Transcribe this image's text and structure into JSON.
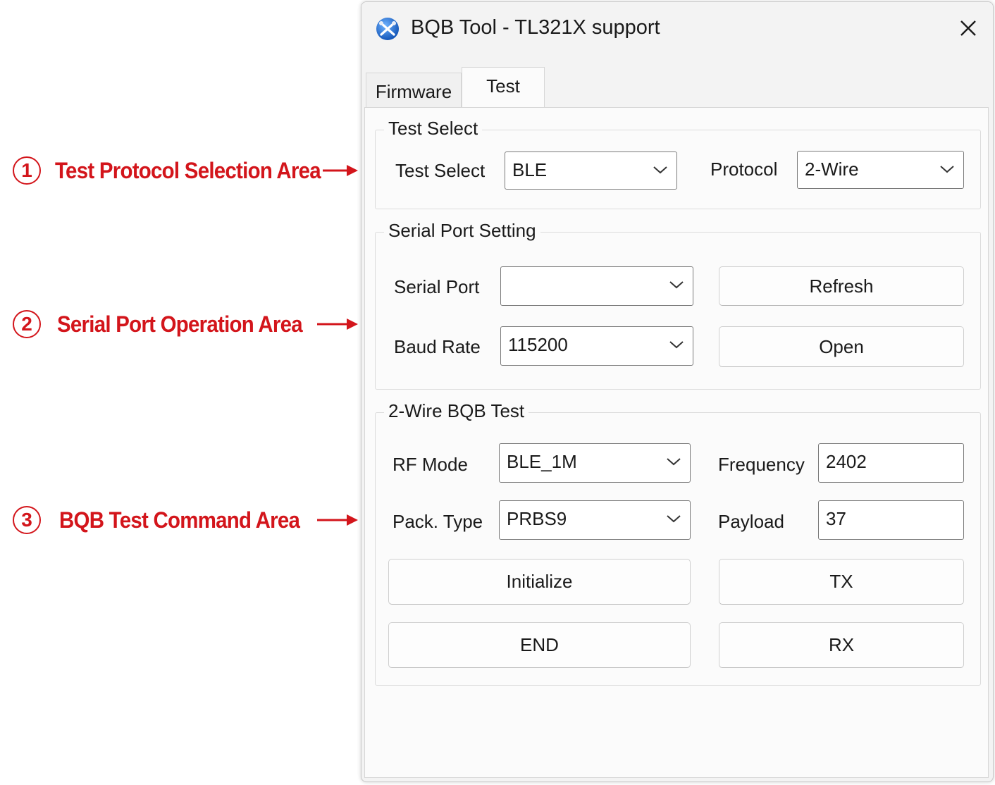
{
  "annotations": [
    {
      "number": "1",
      "text": "Test Protocol Selection Area"
    },
    {
      "number": "2",
      "text": "Serial Port Operation Area"
    },
    {
      "number": "3",
      "text": "BQB Test Command Area"
    }
  ],
  "window": {
    "title": "BQB Tool - TL321X support",
    "icon": "bluetooth-tools-icon",
    "close_icon": "close-icon"
  },
  "tabs": [
    {
      "label": "Firmware",
      "active": false
    },
    {
      "label": "Test",
      "active": true
    }
  ],
  "test_select_group": {
    "title": "Test Select",
    "test_select_label": "Test Select",
    "test_select_value": "BLE",
    "protocol_label": "Protocol",
    "protocol_value": "2-Wire"
  },
  "serial_group": {
    "title": "Serial Port Setting",
    "serial_port_label": "Serial Port",
    "serial_port_value": "",
    "refresh_label": "Refresh",
    "baud_rate_label": "Baud Rate",
    "baud_rate_value": "115200",
    "open_label": "Open"
  },
  "bqb_group": {
    "title": "2-Wire BQB Test",
    "rf_mode_label": "RF Mode",
    "rf_mode_value": "BLE_1M",
    "frequency_label": "Frequency",
    "frequency_value": "2402",
    "pack_type_label": "Pack. Type",
    "pack_type_value": "PRBS9",
    "payload_label": "Payload",
    "payload_value": "37",
    "initialize_label": "Initialize",
    "tx_label": "TX",
    "end_label": "END",
    "rx_label": "RX"
  },
  "colors": {
    "annotation": "#d3151b",
    "window_bg": "#f3f3f3",
    "pane_bg": "#fbfbfb"
  }
}
